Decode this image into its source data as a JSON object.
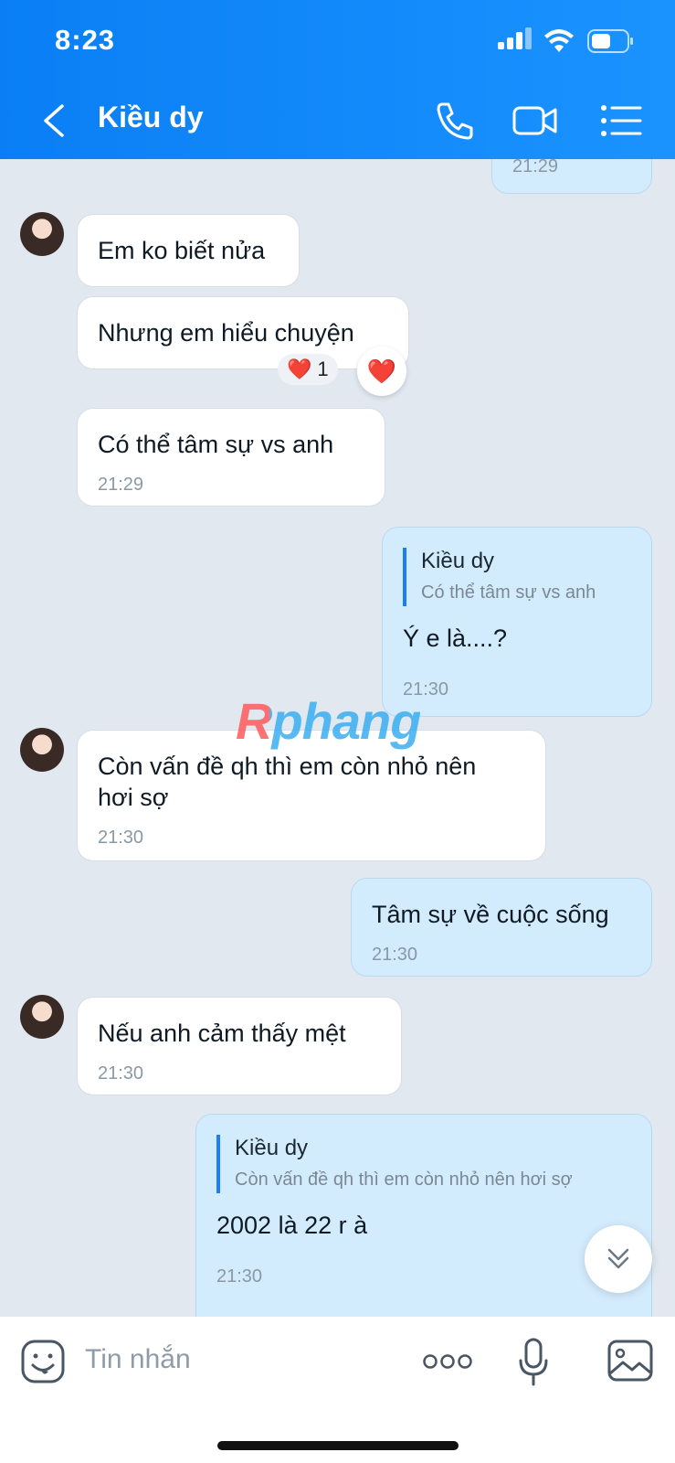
{
  "status_bar": {
    "time": "8:23"
  },
  "header": {
    "title": "Kiều dy",
    "icons": [
      "back-icon",
      "phone-icon",
      "video-call-icon",
      "menu-list-icon"
    ]
  },
  "watermark": "Rphang",
  "messages": [
    {
      "dir": "out",
      "time": "21:29"
    },
    {
      "dir": "in",
      "text": "Em ko biết nửa"
    },
    {
      "dir": "in",
      "text": "Nhưng em hiểu chuyện",
      "reaction": {
        "emoji": "❤️",
        "count": "1"
      }
    },
    {
      "dir": "in",
      "text": "Có thể tâm sự vs anh",
      "time": "21:29"
    },
    {
      "dir": "out",
      "quote": {
        "name": "Kiều dy",
        "text": "Có thể tâm sự vs anh"
      },
      "text": "Ý e là....?",
      "time": "21:30"
    },
    {
      "dir": "in",
      "text": "Còn vấn đề qh thì em còn nhỏ nên hơi sợ",
      "time": "21:30"
    },
    {
      "dir": "out",
      "text": "Tâm sự về cuộc sống",
      "time": "21:30"
    },
    {
      "dir": "in",
      "text": "Nếu anh cảm thấy mệt",
      "time": "21:30"
    },
    {
      "dir": "out",
      "quote": {
        "name": "Kiều dy",
        "text": "Còn vấn đề qh thì em còn nhỏ nên hơi sợ"
      },
      "text": "2002 là 22 r à",
      "time": "21:30"
    }
  ],
  "reaction_button_emoji": "❤️",
  "input": {
    "placeholder": "Tin nhắn",
    "icons": [
      "sticker-icon",
      "more-icon",
      "microphone-icon",
      "image-icon"
    ]
  }
}
